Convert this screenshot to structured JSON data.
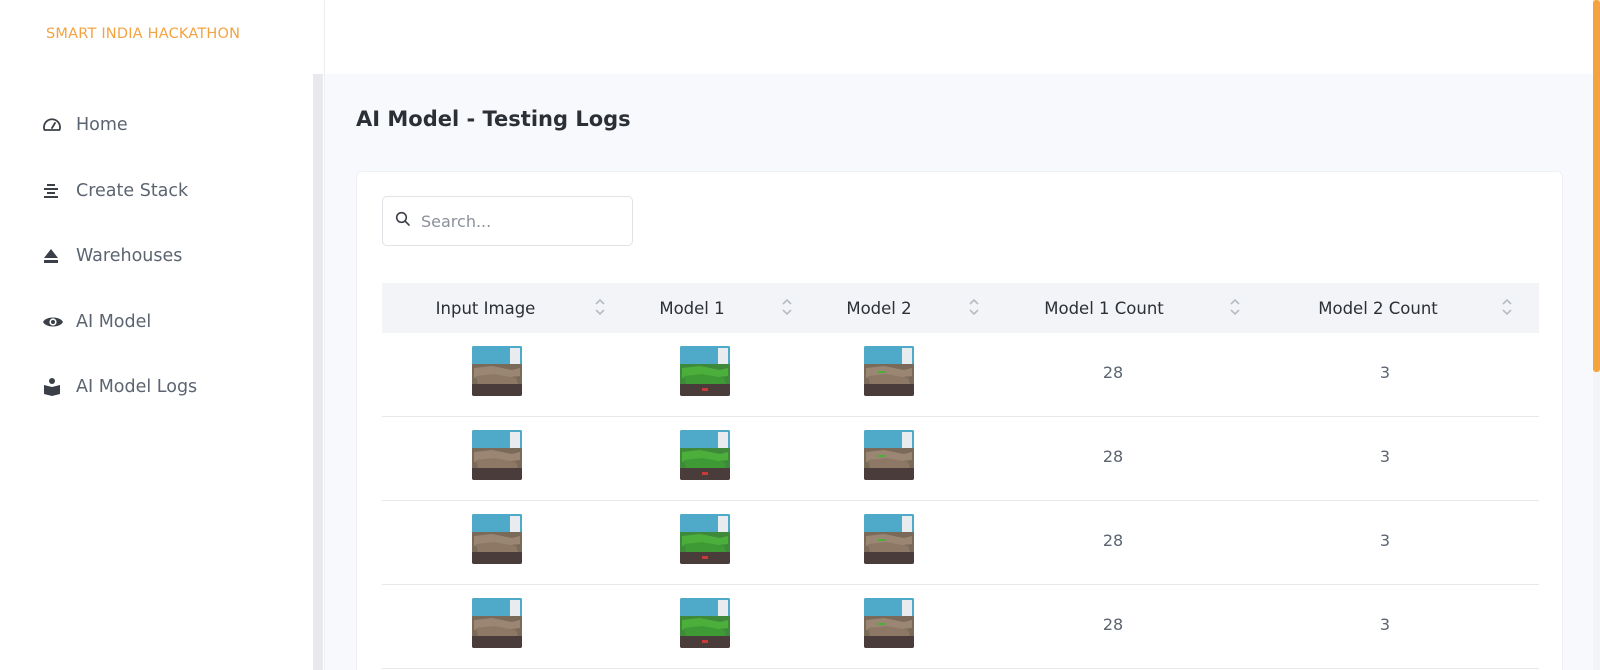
{
  "brand": "SMART INDIA HACKATHON",
  "nav": [
    {
      "label": "Home",
      "icon": "dashboard-gauge-icon"
    },
    {
      "label": "Create Stack",
      "icon": "stack-icon"
    },
    {
      "label": "Warehouses",
      "icon": "eject-icon"
    },
    {
      "label": "AI Model",
      "icon": "eye-icon"
    },
    {
      "label": "AI Model Logs",
      "icon": "person-book-icon"
    }
  ],
  "page": {
    "title": "AI Model - Testing Logs"
  },
  "search": {
    "placeholder": "Search..."
  },
  "table": {
    "columns": [
      "Input Image",
      "Model 1",
      "Model 2",
      "Model 1 Count",
      "Model 2 Count"
    ],
    "rows": [
      {
        "model1_count": "28",
        "model2_count": "3"
      },
      {
        "model1_count": "28",
        "model2_count": "3"
      },
      {
        "model1_count": "28",
        "model2_count": "3"
      },
      {
        "model1_count": "28",
        "model2_count": "3"
      }
    ]
  },
  "colors": {
    "accent": "#f4a340",
    "text": "#2b2f36",
    "muted": "#5b6470",
    "background": "#f8f9fc"
  }
}
